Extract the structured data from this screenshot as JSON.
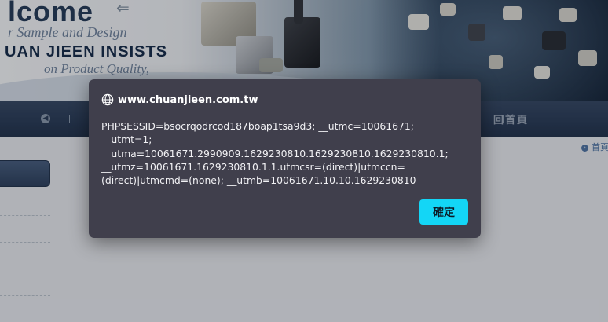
{
  "banner": {
    "title": "lcome",
    "subtitle": "r Sample and Design",
    "brand": "UAN JIEEN INSISTS",
    "tagline": "on Product Quality,"
  },
  "nav": {
    "back_icon": "chevron-left-icon",
    "home_label": "回首頁"
  },
  "breadcrumb": {
    "label": "首頁"
  },
  "dialog": {
    "origin": "www.chuanjieen.com.tw",
    "origin_icon": "globe-icon",
    "message": "PHPSESSID=bsocrqodrcod187boap1tsa9d3; __utmc=10061671;\n__utmt=1;\n__utma=10061671.2990909.1629230810.1629230810.1629230810.1;\n__utmz=10061671.1629230810.1.1.utmcsr=(direct)|utmccn=\n(direct)|utmcmd=(none); __utmb=10061671.10.10.1629230810",
    "ok_label": "確定",
    "accent_color": "#13d6f6",
    "background_color": "#403f4c"
  }
}
